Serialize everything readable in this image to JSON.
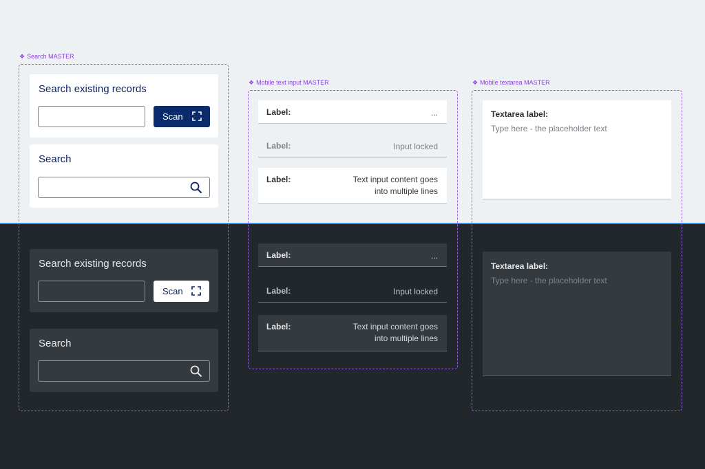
{
  "masters": {
    "search": "Search MASTER",
    "mobile_text_input": "Mobile text input MASTER",
    "mobile_textarea": "Mobile textarea MASTER"
  },
  "search_light": {
    "scan_card": {
      "title": "Search existing records",
      "input_value": "",
      "button_label": "Scan"
    },
    "search_card": {
      "title": "Search",
      "input_value": ""
    }
  },
  "search_dark": {
    "scan_card": {
      "title": "Search existing records",
      "input_value": "",
      "button_label": "Scan"
    },
    "search_card": {
      "title": "Search",
      "input_value": ""
    }
  },
  "mobile_light": {
    "rows": [
      {
        "label": "Label:",
        "value": "..."
      },
      {
        "label": "Label:",
        "value": "Input locked"
      },
      {
        "label": "Label:",
        "value_line1": "Text input content goes",
        "value_line2": "into multiple lines"
      }
    ]
  },
  "mobile_dark": {
    "rows": [
      {
        "label": "Label:",
        "value": "..."
      },
      {
        "label": "Label:",
        "value": "Input locked"
      },
      {
        "label": "Label:",
        "value_line1": "Text input content goes",
        "value_line2": "into multiple lines"
      }
    ]
  },
  "textarea_light": {
    "label": "Textarea label:",
    "placeholder": "Type here - the placeholder text"
  },
  "textarea_dark": {
    "label": "Textarea label:",
    "placeholder": "Type here - the placeholder text"
  },
  "colors": {
    "light_background": "#eef1f4",
    "dark_background": "#22272b",
    "divider": "#3b8ed8",
    "frame_dashed": "#9b5de5",
    "primary_button": "#0a2a6b",
    "title_navy": "#0c2461"
  },
  "icons": [
    "component-diamond-icon",
    "scan-frame-icon",
    "search-icon"
  ]
}
